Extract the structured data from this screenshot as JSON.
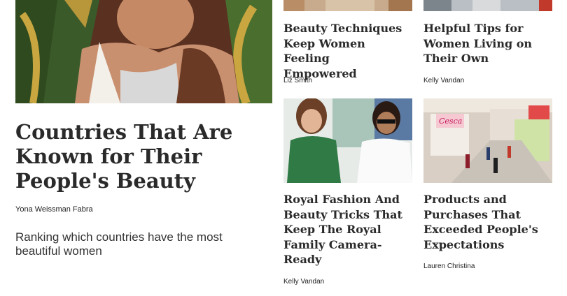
{
  "feature": {
    "title": "Countries That Are Known for Their People's Beauty",
    "author": "Yona Weissman Fabra",
    "description": "Ranking which countries have the most beautiful women"
  },
  "cards": [
    {
      "title": "Beauty Techniques Keep Women Feeling Empowered",
      "author": "Liz Smith"
    },
    {
      "title": "Helpful Tips for Women Living on Their Own",
      "author": "Kelly Vandan"
    },
    {
      "title": "Royal Fashion And Beauty Tricks That Keep The Royal Family Camera-Ready",
      "author": "Kelly Vandan"
    },
    {
      "title": "Products and Purchases That Exceeded People's Expectations",
      "author": "Lauren Christina"
    }
  ],
  "images": {
    "mall_sign": "Cesca"
  }
}
